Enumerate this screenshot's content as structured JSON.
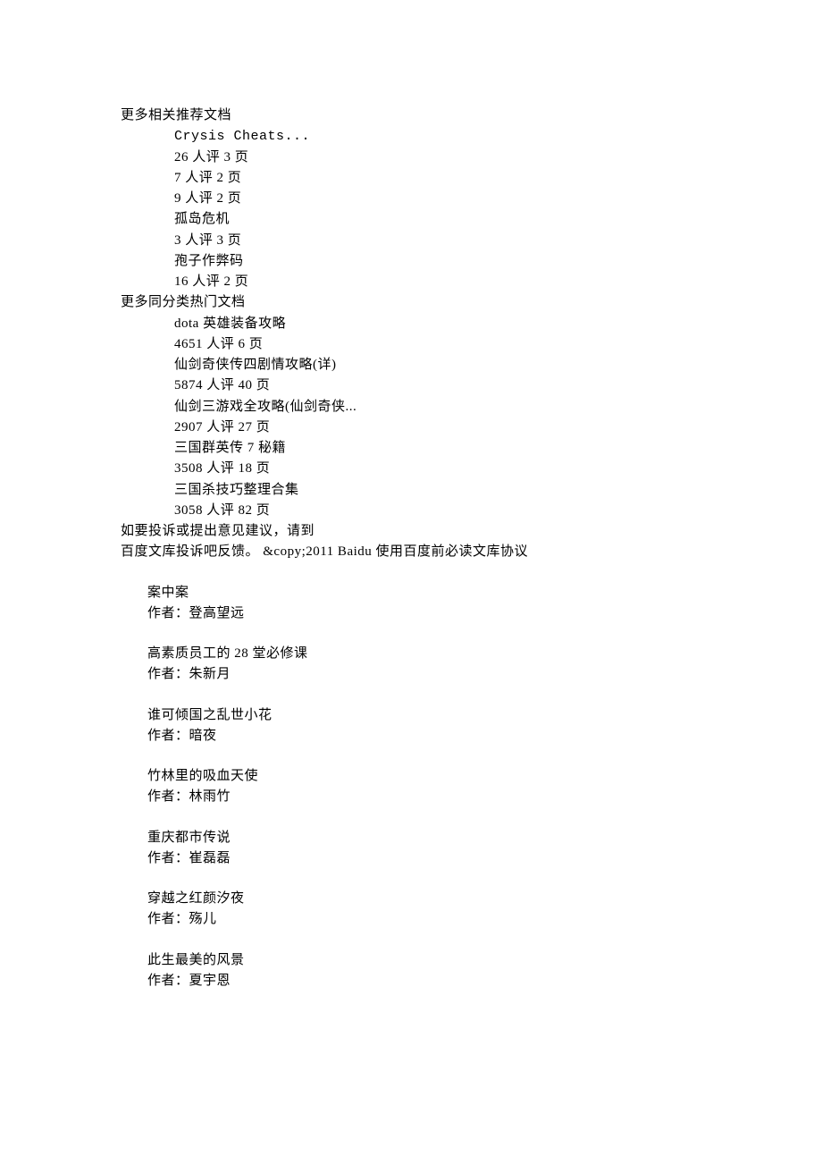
{
  "section1": {
    "title": "更多相关推荐文档",
    "items": [
      {
        "title": "Crysis Cheats...",
        "meta": "26 人评 3 页"
      },
      {
        "title": "",
        "meta": "7 人评 2 页"
      },
      {
        "title": "",
        "meta": "9 人评 2 页"
      },
      {
        "title": "孤岛危机",
        "meta": "3 人评 3 页"
      },
      {
        "title": "孢子作弊码",
        "meta": "16 人评 2 页"
      }
    ]
  },
  "section2": {
    "title": "更多同分类热门文档",
    "items": [
      {
        "title": "dota 英雄装备攻略",
        "meta": "4651 人评 6 页"
      },
      {
        "title": "仙剑奇侠传四剧情攻略(详)",
        "meta": "5874 人评 40 页"
      },
      {
        "title": "仙剑三游戏全攻略(仙剑奇侠...",
        "meta": "2907 人评 27 页"
      },
      {
        "title": "三国群英传 7 秘籍",
        "meta": "3508 人评 18 页"
      },
      {
        "title": "三国杀技巧整理合集",
        "meta": "3058 人评 82 页"
      }
    ]
  },
  "footer": {
    "line1": "如要投诉或提出意见建议，请到",
    "line2": "百度文库投诉吧反馈。 &copy;2011 Baidu 使用百度前必读文库协议"
  },
  "author_label": "作者：",
  "books": [
    {
      "title": "案中案",
      "author": "登高望远"
    },
    {
      "title": "高素质员工的 28 堂必修课",
      "author": "朱新月"
    },
    {
      "title": "谁可倾国之乱世小花",
      "author": "暗夜"
    },
    {
      "title": "竹林里的吸血天使",
      "author": "林雨竹"
    },
    {
      "title": "重庆都市传说",
      "author": "崔磊磊"
    },
    {
      "title": "穿越之红颜汐夜",
      "author": "殇儿"
    },
    {
      "title": "此生最美的风景",
      "author": "夏宇恩"
    }
  ]
}
